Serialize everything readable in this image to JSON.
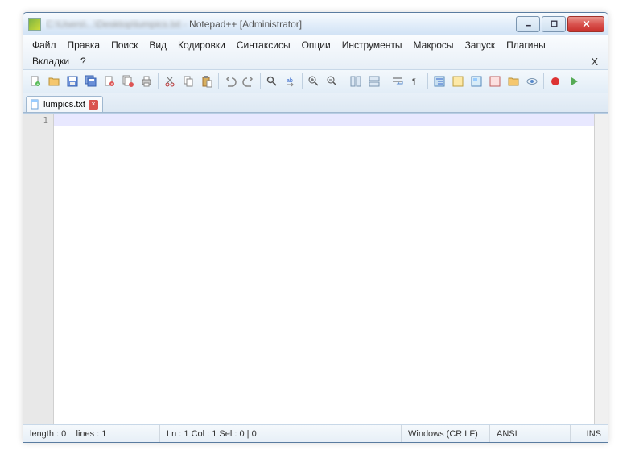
{
  "title": {
    "app": "Notepad++",
    "suffix": "[Administrator]"
  },
  "menu": {
    "items": [
      "Файл",
      "Правка",
      "Поиск",
      "Вид",
      "Кодировки",
      "Синтаксисы",
      "Опции",
      "Инструменты",
      "Макросы",
      "Запуск",
      "Плагины",
      "Вкладки",
      "?"
    ]
  },
  "toolbar": {
    "icons": [
      "new-file",
      "open-file",
      "save",
      "save-all",
      "close",
      "close-all",
      "print",
      "sep",
      "cut",
      "copy",
      "paste",
      "sep",
      "undo",
      "redo",
      "sep",
      "find",
      "replace",
      "sep",
      "zoom-in",
      "zoom-out",
      "sep",
      "sync-v",
      "sync-h",
      "sep",
      "word-wrap",
      "show-all",
      "sep",
      "indent-guide",
      "lang-panel",
      "doc-map",
      "func-list",
      "folder-tree",
      "monitor",
      "sep",
      "record-macro",
      "play-macro"
    ]
  },
  "tabs": [
    {
      "label": "lumpics.txt",
      "active": true
    }
  ],
  "editor": {
    "line_number": "1"
  },
  "status": {
    "length": "length : 0",
    "lines": "lines : 1",
    "pos": "Ln : 1    Col : 1    Sel : 0 | 0",
    "eol": "Windows (CR LF)",
    "encoding": "ANSI",
    "mode": "INS"
  }
}
